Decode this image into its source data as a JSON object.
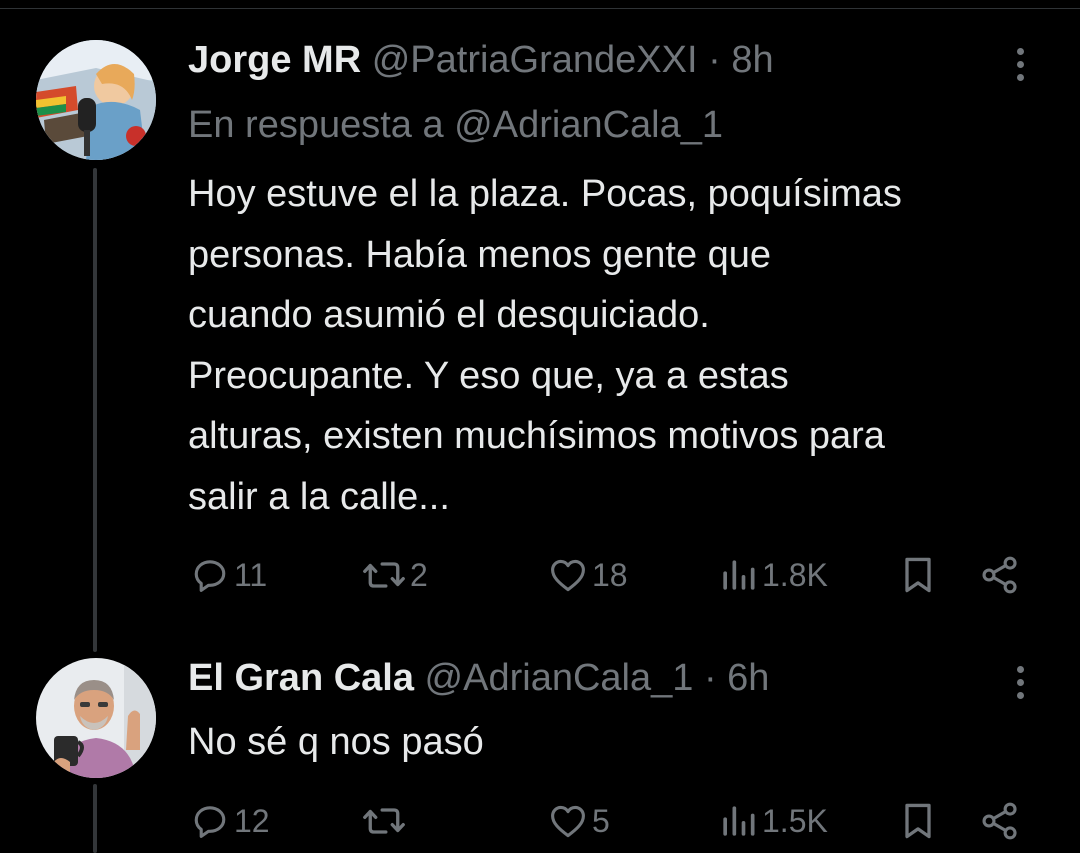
{
  "tweets": [
    {
      "display_name": "Jorge MR",
      "handle": "@PatriaGrandeXXI",
      "separator": "·",
      "time": "8h",
      "reply_prefix": "En respuesta a",
      "reply_mention": "@AdrianCala_1",
      "text": "Hoy estuve el la plaza. Pocas, poquísimas\npersonas. Había menos gente que\ncuando asumió el desquiciado.\nPreocupante. Y eso que, ya a estas\nalturas, existen muchísimos motivos para\nsalir a la calle...",
      "replies": "11",
      "reposts": "2",
      "likes": "18",
      "views": "1.8K"
    },
    {
      "display_name": "El Gran Cala",
      "handle": "@AdrianCala_1",
      "separator": "·",
      "time": "6h",
      "text": "No sé q nos pasó",
      "replies": "12",
      "reposts": "",
      "likes": "5",
      "views": "1.5K"
    }
  ],
  "icons": {
    "reply": "speech-bubble-icon",
    "repost": "repost-arrows-icon",
    "like": "heart-icon",
    "views": "bar-chart-icon",
    "bookmark": "bookmark-icon",
    "share": "share-nodes-icon",
    "more": "vertical-dots-icon"
  },
  "colors": {
    "background": "#000000",
    "primary_text": "#e7e9ea",
    "secondary_text": "#71767b",
    "thread_line": "#333639"
  }
}
